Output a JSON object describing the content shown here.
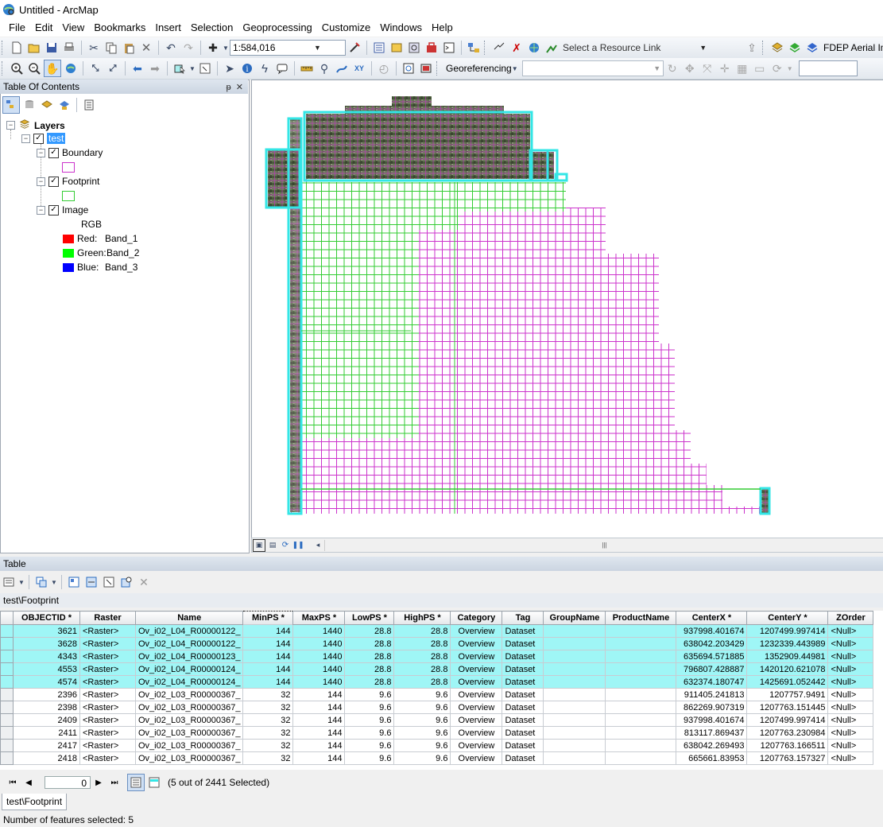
{
  "window": {
    "title": "Untitled - ArcMap"
  },
  "menu": [
    "File",
    "Edit",
    "View",
    "Bookmarks",
    "Insert",
    "Selection",
    "Geoprocessing",
    "Customize",
    "Windows",
    "Help"
  ],
  "toolbar": {
    "scale": "1:584,016",
    "resource_link_placeholder": "Select a Resource Link",
    "fdep_label": "FDEP Aerial Im",
    "georeferencing_label": "Georeferencing"
  },
  "toc": {
    "title": "Table Of Contents",
    "root": "Layers",
    "group": "test",
    "layers": [
      {
        "name": "Boundary",
        "symbol_color": "#cc33cc"
      },
      {
        "name": "Footprint",
        "symbol_color": "#33cc33"
      },
      {
        "name": "Image"
      }
    ],
    "rgb_label": "RGB",
    "bands": [
      {
        "channel": "Red:",
        "band": "Band_1",
        "color": "#ff0000"
      },
      {
        "channel": "Green:",
        "band": "Band_2",
        "color": "#00ff00"
      },
      {
        "channel": "Blue:",
        "band": "Band_3",
        "color": "#0000ff"
      }
    ]
  },
  "table": {
    "title": "Table",
    "layer_name": "test\\Footprint",
    "columns": [
      "OBJECTID *",
      "Raster",
      "Name",
      "MinPS *",
      "MaxPS *",
      "LowPS *",
      "HighPS *",
      "Category",
      "Tag",
      "GroupName",
      "ProductName",
      "CenterX *",
      "CenterY *",
      "ZOrder"
    ],
    "rows": [
      {
        "selected": true,
        "cells": [
          "3621",
          "<Raster>",
          "Ov_i02_L04_R00000122_",
          "144",
          "1440",
          "28.8",
          "28.8",
          "Overview",
          "Dataset",
          "",
          "",
          "937998.401674",
          "1207499.997414",
          "<Null>"
        ]
      },
      {
        "selected": true,
        "cells": [
          "3628",
          "<Raster>",
          "Ov_i02_L04_R00000122_",
          "144",
          "1440",
          "28.8",
          "28.8",
          "Overview",
          "Dataset",
          "",
          "",
          "638042.203429",
          "1232339.443989",
          "<Null>"
        ]
      },
      {
        "selected": true,
        "cells": [
          "4343",
          "<Raster>",
          "Ov_i02_L04_R00000123_",
          "144",
          "1440",
          "28.8",
          "28.8",
          "Overview",
          "Dataset",
          "",
          "",
          "635694.571885",
          "1352909.44981",
          "<Null>"
        ]
      },
      {
        "selected": true,
        "cells": [
          "4553",
          "<Raster>",
          "Ov_i02_L04_R00000124_",
          "144",
          "1440",
          "28.8",
          "28.8",
          "Overview",
          "Dataset",
          "",
          "",
          "796807.428887",
          "1420120.621078",
          "<Null>"
        ]
      },
      {
        "selected": true,
        "cells": [
          "4574",
          "<Raster>",
          "Ov_i02_L04_R00000124_",
          "144",
          "1440",
          "28.8",
          "28.8",
          "Overview",
          "Dataset",
          "",
          "",
          "632374.180747",
          "1425691.052442",
          "<Null>"
        ]
      },
      {
        "selected": false,
        "cells": [
          "2396",
          "<Raster>",
          "Ov_i02_L03_R00000367_",
          "32",
          "144",
          "9.6",
          "9.6",
          "Overview",
          "Dataset",
          "",
          "",
          "911405.241813",
          "1207757.9491",
          "<Null>"
        ]
      },
      {
        "selected": false,
        "cells": [
          "2398",
          "<Raster>",
          "Ov_i02_L03_R00000367_",
          "32",
          "144",
          "9.6",
          "9.6",
          "Overview",
          "Dataset",
          "",
          "",
          "862269.907319",
          "1207763.151445",
          "<Null>"
        ]
      },
      {
        "selected": false,
        "cells": [
          "2409",
          "<Raster>",
          "Ov_i02_L03_R00000367_",
          "32",
          "144",
          "9.6",
          "9.6",
          "Overview",
          "Dataset",
          "",
          "",
          "937998.401674",
          "1207499.997414",
          "<Null>"
        ]
      },
      {
        "selected": false,
        "cells": [
          "2411",
          "<Raster>",
          "Ov_i02_L03_R00000367_",
          "32",
          "144",
          "9.6",
          "9.6",
          "Overview",
          "Dataset",
          "",
          "",
          "813117.869437",
          "1207763.230984",
          "<Null>"
        ]
      },
      {
        "selected": false,
        "cells": [
          "2417",
          "<Raster>",
          "Ov_i02_L03_R00000367_",
          "32",
          "144",
          "9.6",
          "9.6",
          "Overview",
          "Dataset",
          "",
          "",
          "638042.269493",
          "1207763.166511",
          "<Null>"
        ]
      },
      {
        "selected": false,
        "cells": [
          "2418",
          "<Raster>",
          "Ov_i02_L03_R00000367_",
          "32",
          "144",
          "9.6",
          "9.6",
          "Overview",
          "Dataset",
          "",
          "",
          "665661.83953",
          "1207763.157327",
          "<Null>"
        ]
      }
    ],
    "nav_record": "0",
    "selection_status": "(5 out of 2441 Selected)",
    "tab_label": "test\\Footprint"
  },
  "status": {
    "text": "Number of features selected: 5"
  },
  "colors": {
    "selected_row": "#9ff6f6",
    "boundary": "#cc33cc",
    "footprint": "#33cc33",
    "selection": "#33e6e6"
  }
}
